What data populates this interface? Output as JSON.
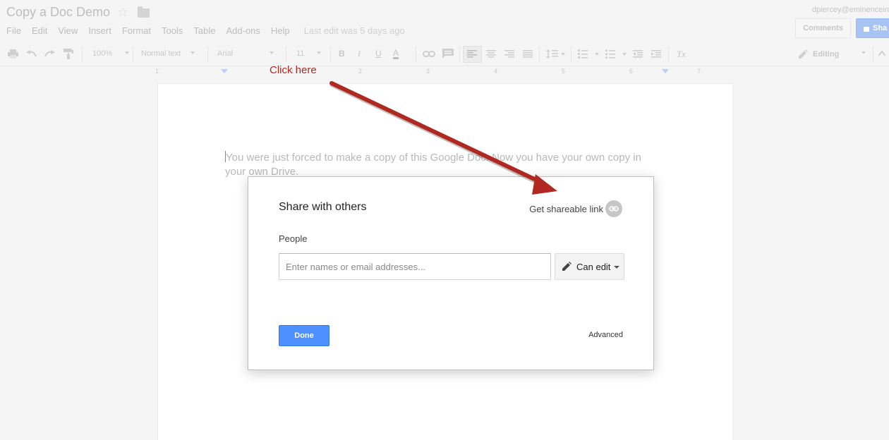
{
  "doc": {
    "title": "Copy a Doc Demo",
    "user_email": "dpiercey@eminencein",
    "comments_label": "Comments",
    "share_label": "Sha",
    "last_edit": "Last edit was 5 days ago",
    "body_text": "You were just forced to make a copy of this Google Doc. Now you have your own copy in your own Drive."
  },
  "menu": [
    "File",
    "Edit",
    "View",
    "Insert",
    "Format",
    "Tools",
    "Table",
    "Add-ons",
    "Help"
  ],
  "toolbar": {
    "zoom": "100%",
    "style": "Normal text",
    "font": "Arial",
    "size": "11",
    "bold": "B",
    "italic": "I",
    "underline": "U",
    "text_color": "A",
    "clear_format": "Tx",
    "mode": "Editing"
  },
  "ruler": [
    "1",
    "1",
    "2",
    "3",
    "4",
    "5",
    "6",
    "7"
  ],
  "callout": {
    "text": "Click here",
    "color": "#b0281f"
  },
  "dialog": {
    "title": "Share with others",
    "get_link_label": "Get shareable link",
    "people_label": "People",
    "input_placeholder": "Enter names or email addresses...",
    "permission": "Can edit",
    "done_label": "Done",
    "advanced_label": "Advanced"
  },
  "colors": {
    "primary_button": "#4d90fe",
    "share_button_dimmed": "#a7c4f5",
    "arrow": "#b0281f"
  },
  "icons": [
    "star-icon",
    "folder-icon",
    "print-icon",
    "undo-icon",
    "redo-icon",
    "paint-format-icon",
    "link-icon",
    "comment-icon",
    "align-left-icon",
    "align-center-icon",
    "align-right-icon",
    "justify-icon",
    "line-spacing-icon",
    "numbered-list-icon",
    "bulleted-list-icon",
    "decrease-indent-icon",
    "increase-indent-icon",
    "clear-formatting-icon",
    "pencil-icon",
    "lock-icon",
    "chain-link-icon"
  ]
}
